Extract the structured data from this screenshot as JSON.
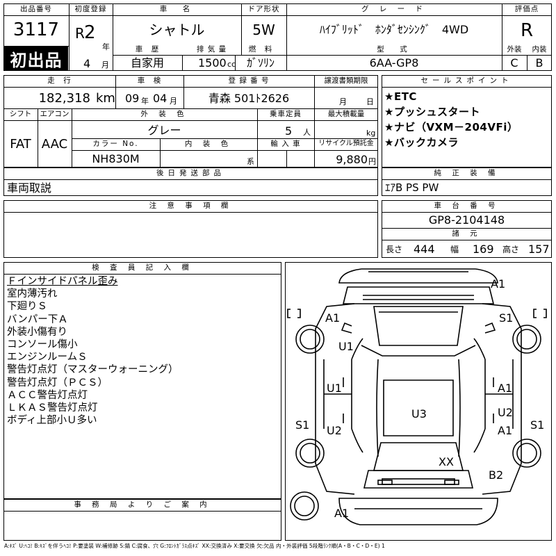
{
  "header": {
    "lot_no_label": "出品番号",
    "lot_no": "3117",
    "first_listing_badge": "初出品",
    "first_reg_label": "初度登録",
    "era": "R",
    "year": "2",
    "year_unit": "年",
    "month": "4",
    "month_unit": "月",
    "car_name_label": "車　名",
    "car_name": "シャトル",
    "history_label": "車　歴",
    "history": "自家用",
    "displacement_label": "排 気 量",
    "displacement": "1500",
    "displacement_unit": "cc",
    "door_label": "ドア形状",
    "door": "5W",
    "fuel_label": "燃　料",
    "fuel": "ｶﾞｿﾘﾝ",
    "grade_label": "グ レ ー ド",
    "grade": "ﾊｲﾌﾞﾘｯﾄﾞ　ﾎﾝﾀﾞｾﾝｼﾝｸﾞ　4WD",
    "model_label": "型　式",
    "model": "6AA-GP8",
    "score_label": "評価点",
    "score": "R",
    "exterior_label": "外装",
    "exterior": "C",
    "interior_label": "内装",
    "interior": "B"
  },
  "row2": {
    "mileage_label": "走　行",
    "mileage": "182,318",
    "mileage_unit": "km",
    "inspection_label": "車　検",
    "inspection_year": "09",
    "inspection_year_unit": "年",
    "inspection_month": "04",
    "inspection_month_unit": "月",
    "plate_label": "登 録 番 号",
    "plate": "青森 501ﾄ2626",
    "transfer_label": "譲渡書類期限",
    "transfer_month_unit": "月",
    "transfer_day_unit": "日",
    "shift_label": "シフト",
    "shift": "FAT",
    "aircon_label": "エアコン",
    "aircon": "AAC",
    "ext_color_label": "外 装 色",
    "ext_color": "グレー",
    "capacity_label": "乗車定員",
    "capacity": "5",
    "capacity_unit": "人",
    "load_label": "最大積載量",
    "load_unit": "kg",
    "color_no_label": "カラー No.",
    "color_no": "NH830M",
    "int_color_label": "内 装 色",
    "int_color_unit": "系",
    "import_label": "輸 入 車",
    "recycle_label": "リサイクル預託金",
    "recycle": "9,880",
    "recycle_unit": "円"
  },
  "sales_points": {
    "label": "セールスポイント",
    "items": [
      "★ETC",
      "★プッシュスタート",
      "★ナビ（VXM－204VFi）",
      "★バックカメラ"
    ]
  },
  "later_parts": {
    "label": "後日発送部品",
    "value": "車両取説"
  },
  "equipment": {
    "label": "純 正 装 備",
    "value": "ｴｱB PS PW"
  },
  "caution": {
    "label": "注 意 事 項 欄"
  },
  "chassis": {
    "label": "車 台 番 号",
    "value": "GP8-2104148",
    "dims_label": "諸 元",
    "length_label": "長さ",
    "length": "444",
    "width_label": "幅",
    "width": "169",
    "height_label": "高さ",
    "height": "157"
  },
  "inspector": {
    "label": "検 査 員 記 入 欄",
    "notes": [
      "Ｆインサイドパネル歪み",
      "室内薄汚れ",
      "下廻りＳ",
      "バンパー下Ａ",
      "外装小傷有り",
      "コンソール傷小",
      "エンジンルームＳ",
      "警告灯点灯（マスターウォーニング）",
      "警告灯点灯（ＰＣＳ）",
      "ＡＣＣ警告灯点灯",
      "ＬＫＡＳ警告灯点灯",
      "ボディ上部小Ｕ多い"
    ]
  },
  "office": {
    "label": "事 務 局 よ り ご 案 内"
  },
  "diagram_marks": {
    "front_bumper": "A1",
    "left_front_fender": "A1",
    "right_front_fender": "S1",
    "hood": "U1",
    "left_front_door": "U1",
    "right_front_door": "A1",
    "left_rear_door": "U2",
    "right_rear_door_upper": "U2",
    "right_rear_door_lower": "A1",
    "left_sill": "S1",
    "right_sill": "S1",
    "roof": "U3",
    "rear_glass": "XX",
    "right_rear_quarter": "B2",
    "rear_bumper": "A1"
  },
  "legend": "A:ｷｽﾞ U:ﾍｺﾐ B:ｷｽﾞを伴うﾍｺﾐ P:要塗装 W:補修跡 S:錆 C:腐食、穴 G:ﾌﾛﾝﾄｶﾞﾗｽ点ｷｽﾞ XX:交換済み X:要交換 欠:欠品 内・外装評価 5段階ﾗﾝｸ順(A・B・C・D・E) 1"
}
